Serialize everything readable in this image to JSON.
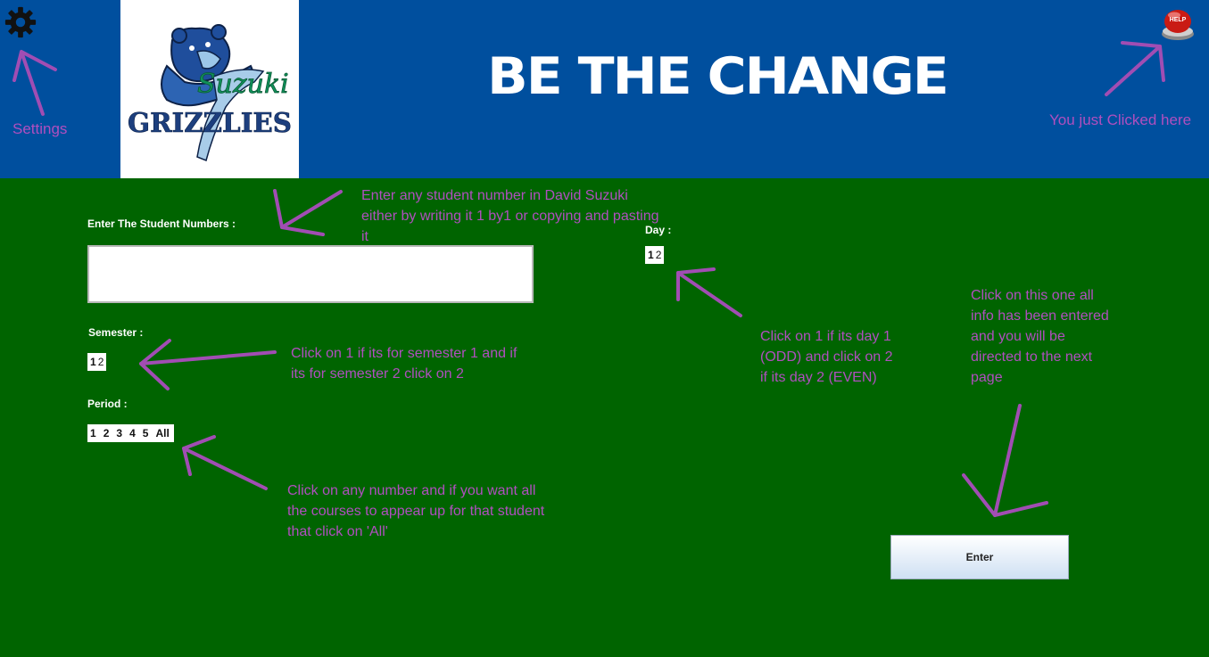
{
  "header": {
    "settings_label": "Settings",
    "slogan": "BE THE CHANGE",
    "help_note": "You just Clicked here",
    "help_icon_text": "HELP"
  },
  "logo": {
    "name": "GRIZZLIES",
    "script": "Suzuki"
  },
  "form": {
    "student_label": "Enter The Student Numbers :",
    "student_value": "",
    "semester_label": "Semester :",
    "semester_options": [
      "1",
      "2"
    ],
    "period_label": "Period :",
    "period_options": [
      "1",
      "2",
      "3",
      "4",
      "5",
      "All"
    ],
    "day_label": "Day :",
    "day_options": [
      "1",
      "2"
    ],
    "enter_label": "Enter"
  },
  "notes": {
    "student": "Enter any student number in David Suzuki either by writing it 1 by1 or copying and pasting it",
    "semester": "Click on 1 if its for semester 1 and if its for semester 2 click on 2",
    "period": "Click on any number and if you want all the courses to appear up for that student that click on 'All'",
    "day": "Click on 1 if its day 1 (ODD) and click on 2 if its day 2 (EVEN)",
    "enter": "Click on this one all info has been entered and you will be directed to the next page"
  },
  "colors": {
    "header_bg": "#004f9e",
    "main_bg": "#006400",
    "annotation": "#b04fbf"
  },
  "icons": [
    "gear-icon",
    "help-button-icon",
    "grizzly-logo"
  ]
}
